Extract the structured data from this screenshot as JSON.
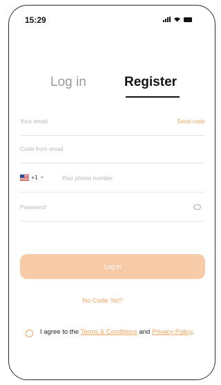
{
  "status_bar": {
    "time": "15:29",
    "icons": [
      "signal-icon",
      "wifi-icon",
      "battery-icon"
    ]
  },
  "tabs": {
    "login": "Log in",
    "register": "Register",
    "active": "Register"
  },
  "form": {
    "email_placeholder": "Your email",
    "send_code": "Send code",
    "code_placeholder": "Code from email",
    "country_code": "+1",
    "country_flag": "us-flag-icon",
    "phone_placeholder": "Your phone number",
    "password_placeholder": "Password",
    "password_visibility_icon": "eye-icon"
  },
  "login_button": "Log in",
  "no_code_link": "No Code Yet?",
  "agreement": {
    "prefix": "I agree to the ",
    "terms": "Terms & Conditions",
    "middle": " and ",
    "privacy": "Privacy Policy",
    "suffix": "."
  },
  "colors": {
    "accent": "#f5a25a",
    "button_disabled": "#f8cba8"
  }
}
